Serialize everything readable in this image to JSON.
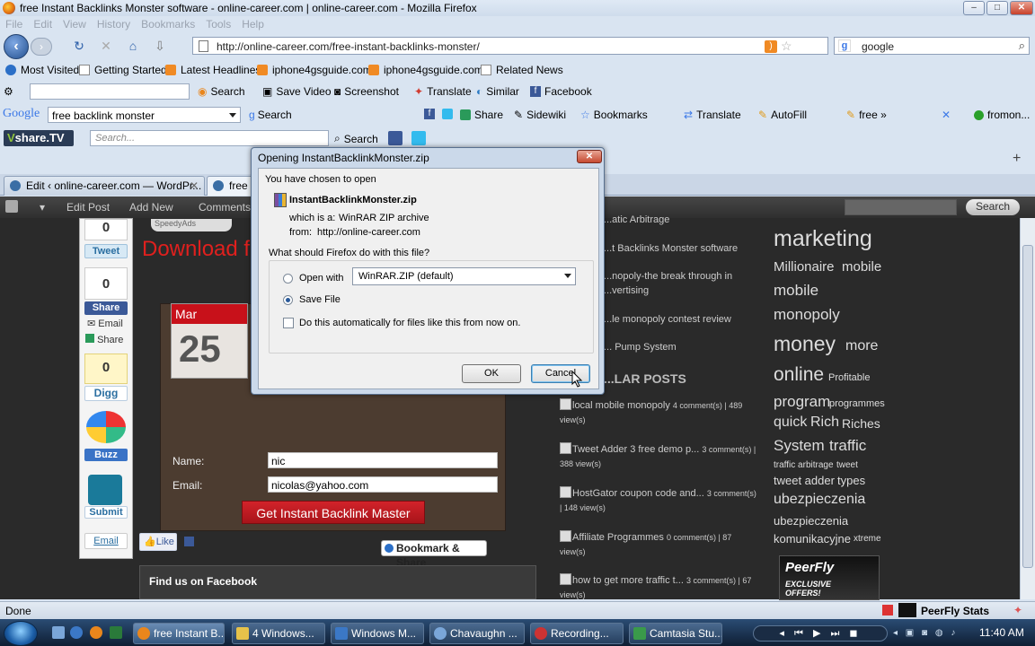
{
  "window": {
    "title": "free Instant Backlinks Monster software - online-career.com | online-career.com - Mozilla Firefox",
    "controls": [
      "–",
      "□",
      "✕"
    ]
  },
  "menu": [
    "File",
    "Edit",
    "View",
    "History",
    "Bookmarks",
    "Tools",
    "Help"
  ],
  "nav": {
    "url": "http://online-career.com/free-instant-backlinks-monster/",
    "search_value": "google"
  },
  "bookmarks": [
    "Most Visited",
    "Getting Started",
    "Latest Headlines",
    "iphone4gsguide.com",
    "iphone4gsguide.com",
    "Related News"
  ],
  "toolbar3": {
    "search": "Search",
    "save_video": "Save Video",
    "screenshot": "Screenshot",
    "translate": "Translate",
    "similar": "Similar",
    "facebook": "Facebook"
  },
  "google_toolbar": {
    "logo": "Google",
    "query": "free backlink monster",
    "search": "Search",
    "share": "Share",
    "sidewiki": "Sidewiki",
    "bookmarks": "Bookmarks",
    "translate": "Translate",
    "autofill": "AutoFill",
    "free": "free »",
    "fromon": "fromon..."
  },
  "vshare": {
    "logo": "share.TV",
    "search_placeholder": "Search...",
    "search": "Search"
  },
  "tabs": [
    {
      "label": "Edit ‹ online-career.com — WordPr..."
    },
    {
      "label": "free"
    }
  ],
  "wp_bar": {
    "edit_post": "Edit Post",
    "add_new": "Add New",
    "comments": "Comments",
    "search": "Search"
  },
  "share_column": {
    "tweet_count": "0",
    "tweet": "Tweet",
    "fb_count": "0",
    "fb_share": "Share",
    "email": "Email",
    "share": "Share",
    "digg_count": "0",
    "digg": "Digg",
    "buzz": "Buzz",
    "submit": "Submit",
    "email2": "Email"
  },
  "main": {
    "speedy": "SpeedyAds",
    "heading": "Download f",
    "calendar_month": "Mar",
    "calendar_day": "25",
    "name_label": "Name:",
    "name_value": "nic",
    "email_label": "Email:",
    "email_value": "nicolas@yahoo.com",
    "cta": "Get Instant Backlink Master",
    "like": "Like",
    "bookmark_share": "Bookmark & Share",
    "find_us": "Find us on Facebook"
  },
  "sidebar": {
    "recent": [
      "...atic Arbitrage",
      "...t Backlinks Monster software",
      "...nopoly-the break through in",
      "...vertising",
      "...le monopoly contest review",
      "... Pump System"
    ],
    "popular_heading": "...LAR POSTS",
    "popular": [
      {
        "title": "local mobile monopoly",
        "meta": "4 comment(s) | 489",
        "views": "view(s)"
      },
      {
        "title": "Tweet Adder 3 free demo p...",
        "meta": "3 comment(s) |",
        "views": "388 view(s)"
      },
      {
        "title": "HostGator coupon code and...",
        "meta": "3 comment(s)",
        "views": "| 148 view(s)"
      },
      {
        "title": "Affiliate Programmes",
        "meta": "0 comment(s) | 87",
        "views": "view(s)"
      },
      {
        "title": "how to get more traffic t...",
        "meta": "3 comment(s) | 67",
        "views": "view(s)"
      }
    ]
  },
  "tagcloud": [
    "marketing",
    "Millionaire",
    "mobile",
    "mobile",
    "monopoly",
    "money",
    "more",
    "online",
    "Profitable",
    "program",
    "programmes",
    "quick",
    "Rich",
    "Riches",
    "System",
    "traffic",
    "traffic arbitrage",
    "tweet",
    "tweet adder",
    "types",
    "ubezpieczenia",
    "ubezpieczenia",
    "komunikacyjne",
    "xtreme"
  ],
  "peerfly": {
    "logo": "PeerFly",
    "tagline": "EXCLUSIVE OFFERS!"
  },
  "status": {
    "text": "Done",
    "peerfly": "PeerFly Stats"
  },
  "taskbar": {
    "items": [
      "free Instant B...",
      "4 Windows...",
      "Windows M...",
      "Chavaughn ...",
      "Recording...",
      "Camtasia Stu..."
    ],
    "clock": "11:40 AM"
  },
  "dialog": {
    "title": "Opening InstantBacklinkMonster.zip",
    "chosen": "You have chosen to open",
    "filename": "InstantBacklinkMonster.zip",
    "which_is_label": "which is a:",
    "which_is_value": "WinRAR ZIP archive",
    "from_label": "from:",
    "from_value": "http://online-career.com",
    "question": "What should Firefox do with this file?",
    "open_with": "Open with",
    "open_with_app": "WinRAR.ZIP (default)",
    "save_file": "Save File",
    "auto": "Do this automatically for files like this from now on.",
    "ok": "OK",
    "cancel": "Cancel"
  },
  "colors": {
    "accent": "#c8111a",
    "firefox_blue": "#2b5ea8",
    "panel_brown": "#4c3c30"
  }
}
